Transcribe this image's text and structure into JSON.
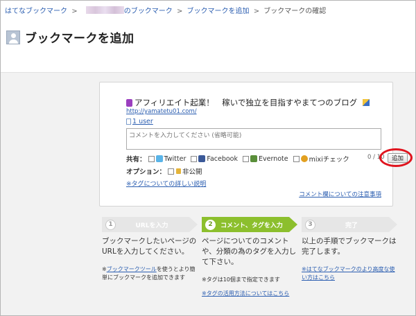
{
  "breadcrumb": {
    "home": "はてなブックマーク",
    "user_bookmarks": "のブックマーク",
    "add": "ブックマークを追加",
    "current": "ブックマークの確認"
  },
  "page": {
    "title": "ブックマークを追加"
  },
  "entry": {
    "title": "アフィリエイト起業！　稼いで独立を目指すやまてつのブログ",
    "url": "http://yamatetu01.com/",
    "users": "1 user"
  },
  "comment": {
    "placeholder": "コメントを入力してください (省略可能)",
    "counter": "0 / 10"
  },
  "share": {
    "label": "共有：",
    "services": [
      "Twitter",
      "Facebook",
      "Evernote",
      "mixiチェック"
    ],
    "add_button": "追加"
  },
  "options": {
    "label": "オプション：",
    "private": "非公開"
  },
  "links": {
    "tag_help": "※タグについての詳しい説明",
    "comment_notes": "コメント欄についての注意事項"
  },
  "steps": [
    {
      "num": "1",
      "label": "URLを入力",
      "desc": "ブックマークしたいページのURLを入力してください。",
      "note_prefix": "※",
      "note_link": "ブックマークツール",
      "note_suffix": "を使うとより簡単にブックマークを追加できます"
    },
    {
      "num": "2",
      "label": "コメント、タグを入力",
      "desc": "ページについてのコメントや、分類の為のタグを入力して下さい。",
      "note": "※タグは10個まで指定できます",
      "note2": "※タグの活用方法についてはこちら"
    },
    {
      "num": "3",
      "label": "完了",
      "desc": "以上の手順でブックマークは完了します。",
      "note": "※はてなブックマークのより高度な使い方はこちら"
    }
  ],
  "colors": {
    "link": "#2a5db0",
    "active_step": "#8cbf2d",
    "highlight_ring": "#e0141e"
  }
}
